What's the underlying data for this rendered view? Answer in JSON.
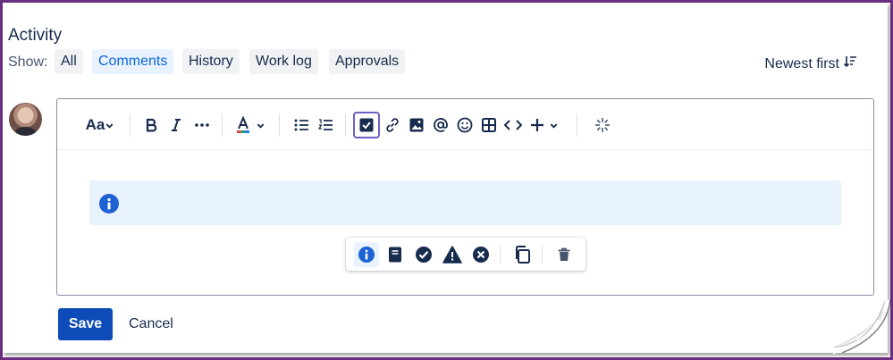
{
  "activity": {
    "title": "Activity",
    "show_label": "Show:",
    "filters": [
      {
        "label": "All",
        "selected": false
      },
      {
        "label": "Comments",
        "selected": true
      },
      {
        "label": "History",
        "selected": false
      },
      {
        "label": "Work log",
        "selected": false
      },
      {
        "label": "Approvals",
        "selected": false
      }
    ],
    "sort_label": "Newest first"
  },
  "toolbar": {
    "text_style_label": "Aa",
    "buttons": [
      "text-style",
      "bold",
      "italic",
      "more-formatting",
      "text-color",
      "bullet-list",
      "numbered-list",
      "action-item",
      "link",
      "image",
      "mention",
      "emoji",
      "table",
      "code",
      "insert",
      "ai"
    ]
  },
  "panel": {
    "type": "info",
    "floating_options": [
      "info",
      "note",
      "success",
      "warning",
      "error",
      "copy",
      "delete"
    ]
  },
  "actions": {
    "save_label": "Save",
    "cancel_label": "Cancel"
  },
  "colors": {
    "brand_blue": "#0c4bb8",
    "selected_filter_bg": "#e9f2ff",
    "info_panel_bg": "#e9f2ff",
    "active_toolbar_border": "#6e5dc6",
    "frame_border": "#6b2d7f"
  }
}
